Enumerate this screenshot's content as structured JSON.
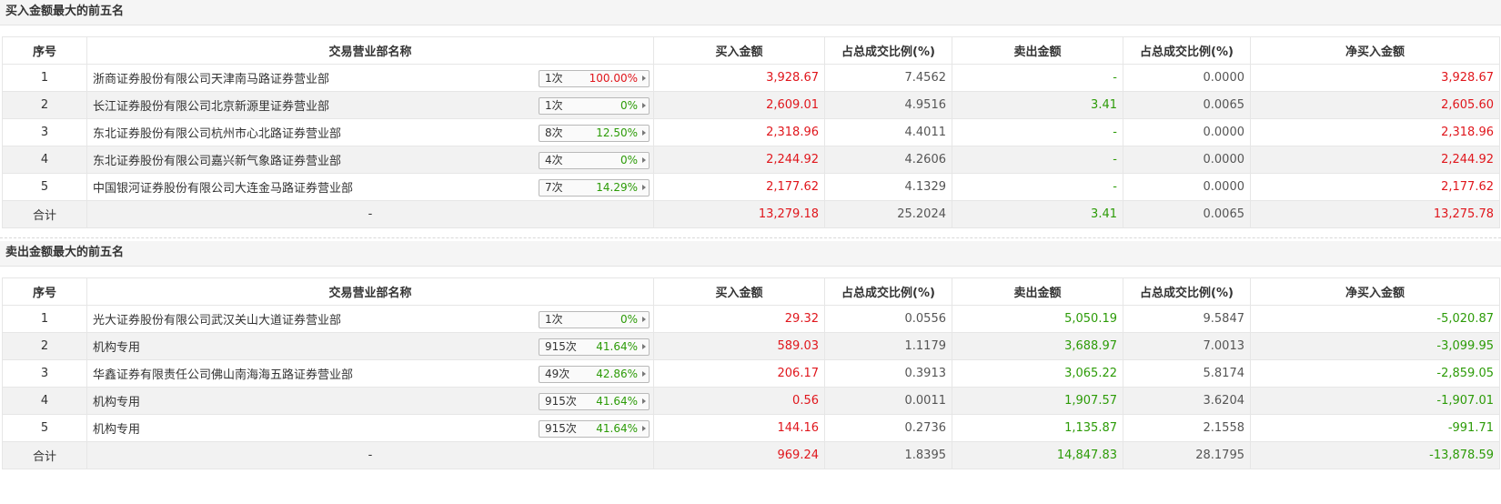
{
  "buy_section": {
    "title": "买入金额最大的前五名",
    "headers": [
      "序号",
      "交易营业部名称",
      "买入金额",
      "占总成交比例(%)",
      "卖出金额",
      "占总成交比例(%)",
      "净买入金额"
    ],
    "rows": [
      {
        "no": "1",
        "name": "浙商证券股份有限公司天津南马路证券营业部",
        "count": "1次",
        "pct": "100.00%",
        "buy": "3,928.67",
        "buy_ratio": "7.4562",
        "sell": "-",
        "sell_ratio": "0.0000",
        "net": "3,928.67"
      },
      {
        "no": "2",
        "name": "长江证券股份有限公司北京新源里证券营业部",
        "count": "1次",
        "pct": "0%",
        "buy": "2,609.01",
        "buy_ratio": "4.9516",
        "sell": "3.41",
        "sell_ratio": "0.0065",
        "net": "2,605.60"
      },
      {
        "no": "3",
        "name": "东北证券股份有限公司杭州市心北路证券营业部",
        "count": "8次",
        "pct": "12.50%",
        "buy": "2,318.96",
        "buy_ratio": "4.4011",
        "sell": "-",
        "sell_ratio": "0.0000",
        "net": "2,318.96"
      },
      {
        "no": "4",
        "name": "东北证券股份有限公司嘉兴新气象路证券营业部",
        "count": "4次",
        "pct": "0%",
        "buy": "2,244.92",
        "buy_ratio": "4.2606",
        "sell": "-",
        "sell_ratio": "0.0000",
        "net": "2,244.92"
      },
      {
        "no": "5",
        "name": "中国银河证券股份有限公司大连金马路证券营业部",
        "count": "7次",
        "pct": "14.29%",
        "buy": "2,177.62",
        "buy_ratio": "4.1329",
        "sell": "-",
        "sell_ratio": "0.0000",
        "net": "2,177.62"
      }
    ],
    "total": {
      "label": "合计",
      "name": "-",
      "buy": "13,279.18",
      "buy_ratio": "25.2024",
      "sell": "3.41",
      "sell_ratio": "0.0065",
      "net": "13,275.78"
    }
  },
  "sell_section": {
    "title": "卖出金额最大的前五名",
    "headers": [
      "序号",
      "交易营业部名称",
      "买入金额",
      "占总成交比例(%)",
      "卖出金额",
      "占总成交比例(%)",
      "净买入金额"
    ],
    "rows": [
      {
        "no": "1",
        "name": "光大证券股份有限公司武汉关山大道证券营业部",
        "count": "1次",
        "pct": "0%",
        "buy": "29.32",
        "buy_ratio": "0.0556",
        "sell": "5,050.19",
        "sell_ratio": "9.5847",
        "net": "-5,020.87"
      },
      {
        "no": "2",
        "name": "机构专用",
        "count": "915次",
        "pct": "41.64%",
        "buy": "589.03",
        "buy_ratio": "1.1179",
        "sell": "3,688.97",
        "sell_ratio": "7.0013",
        "net": "-3,099.95"
      },
      {
        "no": "3",
        "name": "华鑫证券有限责任公司佛山南海海五路证券营业部",
        "count": "49次",
        "pct": "42.86%",
        "buy": "206.17",
        "buy_ratio": "0.3913",
        "sell": "3,065.22",
        "sell_ratio": "5.8174",
        "net": "-2,859.05"
      },
      {
        "no": "4",
        "name": "机构专用",
        "count": "915次",
        "pct": "41.64%",
        "buy": "0.56",
        "buy_ratio": "0.0011",
        "sell": "1,907.57",
        "sell_ratio": "3.6204",
        "net": "-1,907.01"
      },
      {
        "no": "5",
        "name": "机构专用",
        "count": "915次",
        "pct": "41.64%",
        "buy": "144.16",
        "buy_ratio": "0.2736",
        "sell": "1,135.87",
        "sell_ratio": "2.1558",
        "net": "-991.71"
      }
    ],
    "total": {
      "label": "合计",
      "name": "-",
      "buy": "969.24",
      "buy_ratio": "1.8395",
      "sell": "14,847.83",
      "sell_ratio": "28.1795",
      "net": "-13,878.59"
    }
  },
  "colors": {
    "positive": "#e0161c",
    "negative": "#2c9b07",
    "header_bg": "#f5f5f5",
    "stripe": "#f2f2f2"
  },
  "icons": {
    "badge_arrow": "caret-right-icon"
  }
}
